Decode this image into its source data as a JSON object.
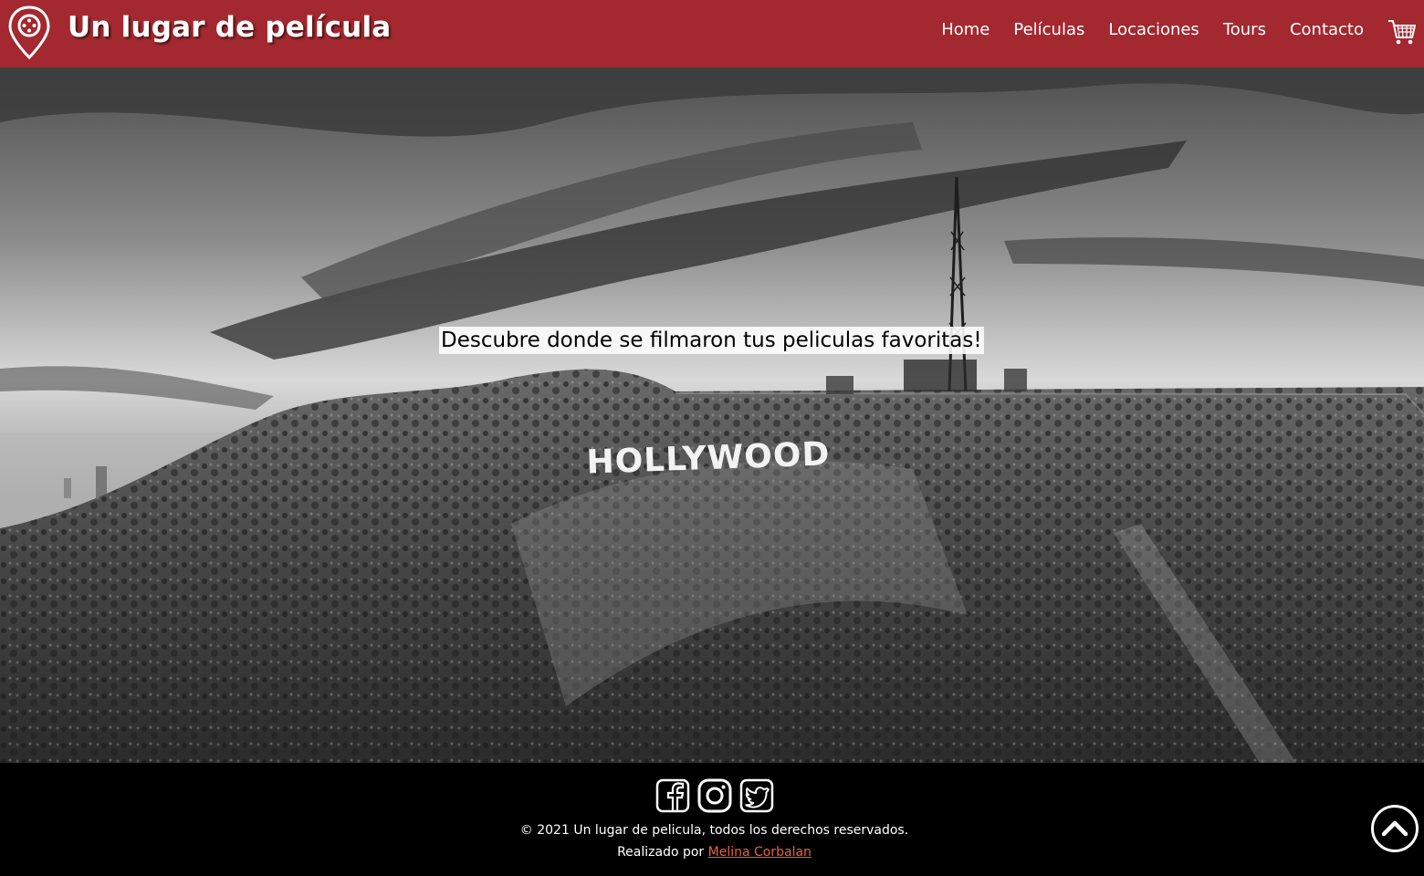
{
  "header": {
    "brand": "Un lugar de película",
    "logo_icon": "map-pin-icon",
    "cart_icon": "shopping-cart-icon",
    "nav": [
      "Home",
      "Películas",
      "Locaciones",
      "Tours",
      "Contacto"
    ],
    "background_color": "#a3282f"
  },
  "hero": {
    "tagline": "Descubre donde se filmaron tus peliculas favoritas!",
    "sign_text": "HOLLYWOOD"
  },
  "footer": {
    "socials": [
      "facebook-icon",
      "instagram-icon",
      "twitter-icon"
    ],
    "copyright": "© 2021 Un lugar de pelicula, todos los derechos reservados.",
    "made_by_prefix": "Realizado por",
    "author": "Melina Corbalan",
    "author_color": "#e8623a",
    "scroll_top_icon": "chevron-up-circle-icon"
  }
}
